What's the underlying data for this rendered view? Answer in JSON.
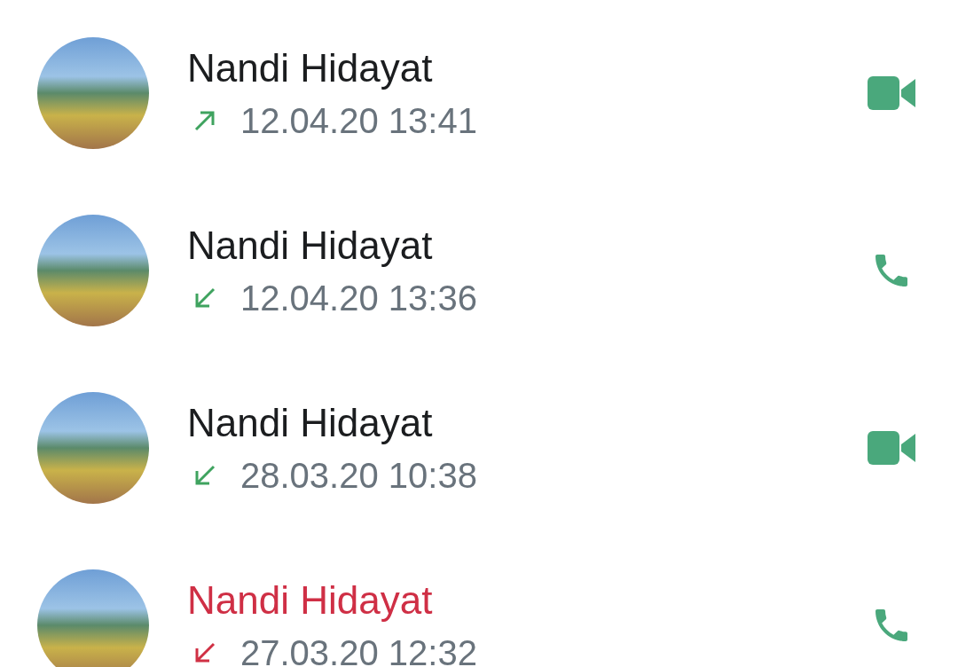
{
  "calls": [
    {
      "name": "Nandi Hidayat",
      "missed": false,
      "outgoing": true,
      "time": "12.04.20 13:41",
      "kind": "video"
    },
    {
      "name": "Nandi Hidayat",
      "missed": false,
      "outgoing": false,
      "time": "12.04.20 13:36",
      "kind": "voice"
    },
    {
      "name": "Nandi Hidayat",
      "missed": false,
      "outgoing": false,
      "time": "28.03.20 10:38",
      "kind": "video"
    },
    {
      "name": "Nandi Hidayat",
      "missed": true,
      "outgoing": false,
      "time": "27.03.20 12:32",
      "kind": "voice"
    }
  ]
}
